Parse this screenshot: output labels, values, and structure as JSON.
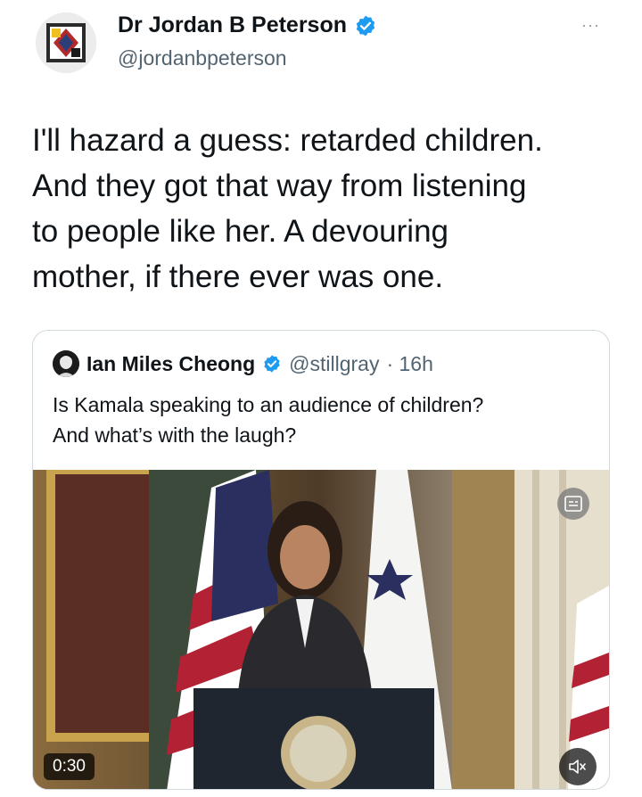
{
  "tweet": {
    "author_name": "Dr Jordan B Peterson",
    "author_handle": "@jordanbpeterson",
    "more_glyph": "···",
    "text": "I'll hazard a guess:  retarded children.\nAnd they got that way from listening\nto people like her. A devouring\nmother, if there ever was one."
  },
  "quoted": {
    "author_name": "Ian Miles Cheong",
    "author_handle": "@stillgray",
    "time": "· 16h",
    "text": "Is Kamala speaking to an audience of children?\nAnd what’s with the laugh?",
    "video": {
      "duration": "0:30",
      "mute_icon": "speaker-muted-icon",
      "badge_icon": "captions-icon"
    }
  },
  "colors": {
    "verified_blue": "#1d9bf0",
    "text": "#0f1419",
    "secondary": "#536471",
    "border": "#cfd9de"
  }
}
